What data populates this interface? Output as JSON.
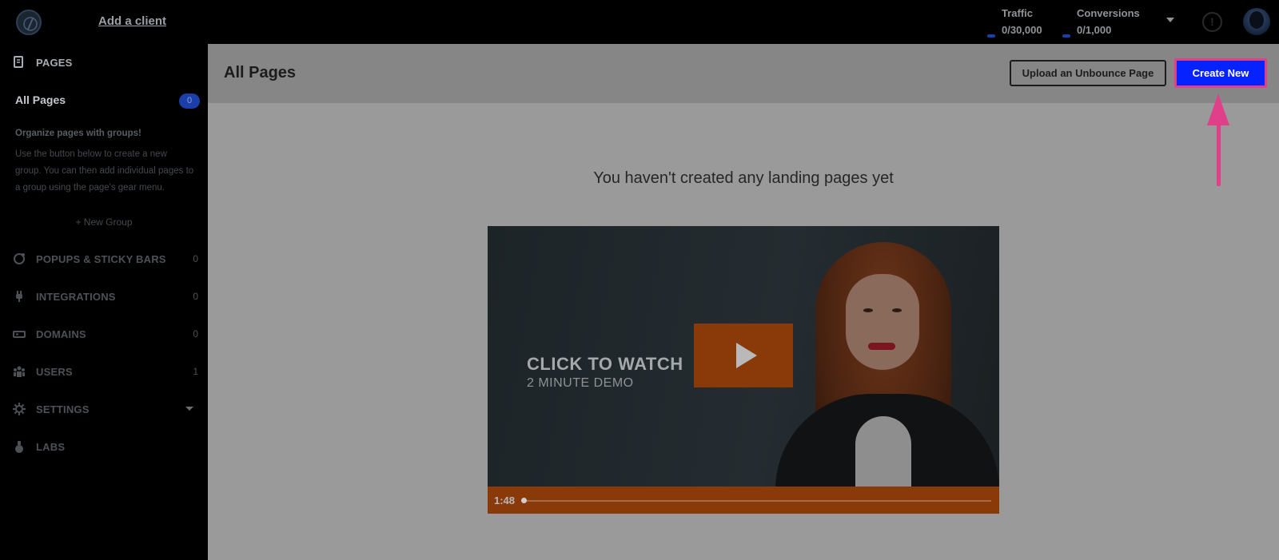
{
  "topbar": {
    "add_client": "Add a client",
    "traffic_label": "Traffic",
    "traffic_value": "0/30,000",
    "conversions_label": "Conversions",
    "conversions_value": "0/1,000",
    "help_icon": "!",
    "icons": [
      "logo-icon",
      "chevron-down-icon",
      "help-icon",
      "avatar"
    ]
  },
  "sidebar": {
    "pages_label": "PAGES",
    "all_pages": "All Pages",
    "all_pages_count": "0",
    "org_title": "Organize pages with groups!",
    "org_desc": "Use the button below to create a new group. You can then add individual pages to a group using the page's gear menu.",
    "new_group": "+ New Group",
    "items": [
      {
        "label": "POPUPS & STICKY BARS",
        "count": "0",
        "icon": "popup-icon"
      },
      {
        "label": "INTEGRATIONS",
        "count": "0",
        "icon": "plug-icon"
      },
      {
        "label": "DOMAINS",
        "count": "0",
        "icon": "domain-icon"
      },
      {
        "label": "USERS",
        "count": "1",
        "icon": "users-icon"
      },
      {
        "label": "SETTINGS",
        "count": "",
        "icon": "gear-icon"
      },
      {
        "label": "LABS",
        "count": "",
        "icon": "flask-icon"
      }
    ]
  },
  "main": {
    "title": "All Pages",
    "upload_button": "Upload an Unbounce Page",
    "create_button": "Create New",
    "empty_message": "You haven't created any landing pages yet",
    "video": {
      "title": "CLICK TO WATCH",
      "subtitle": "2 MINUTE DEMO",
      "duration": "1:48"
    }
  },
  "colors": {
    "accent_blue": "#0522ff",
    "highlight_pink": "#e0408a",
    "video_orange": "#8a3a08"
  }
}
